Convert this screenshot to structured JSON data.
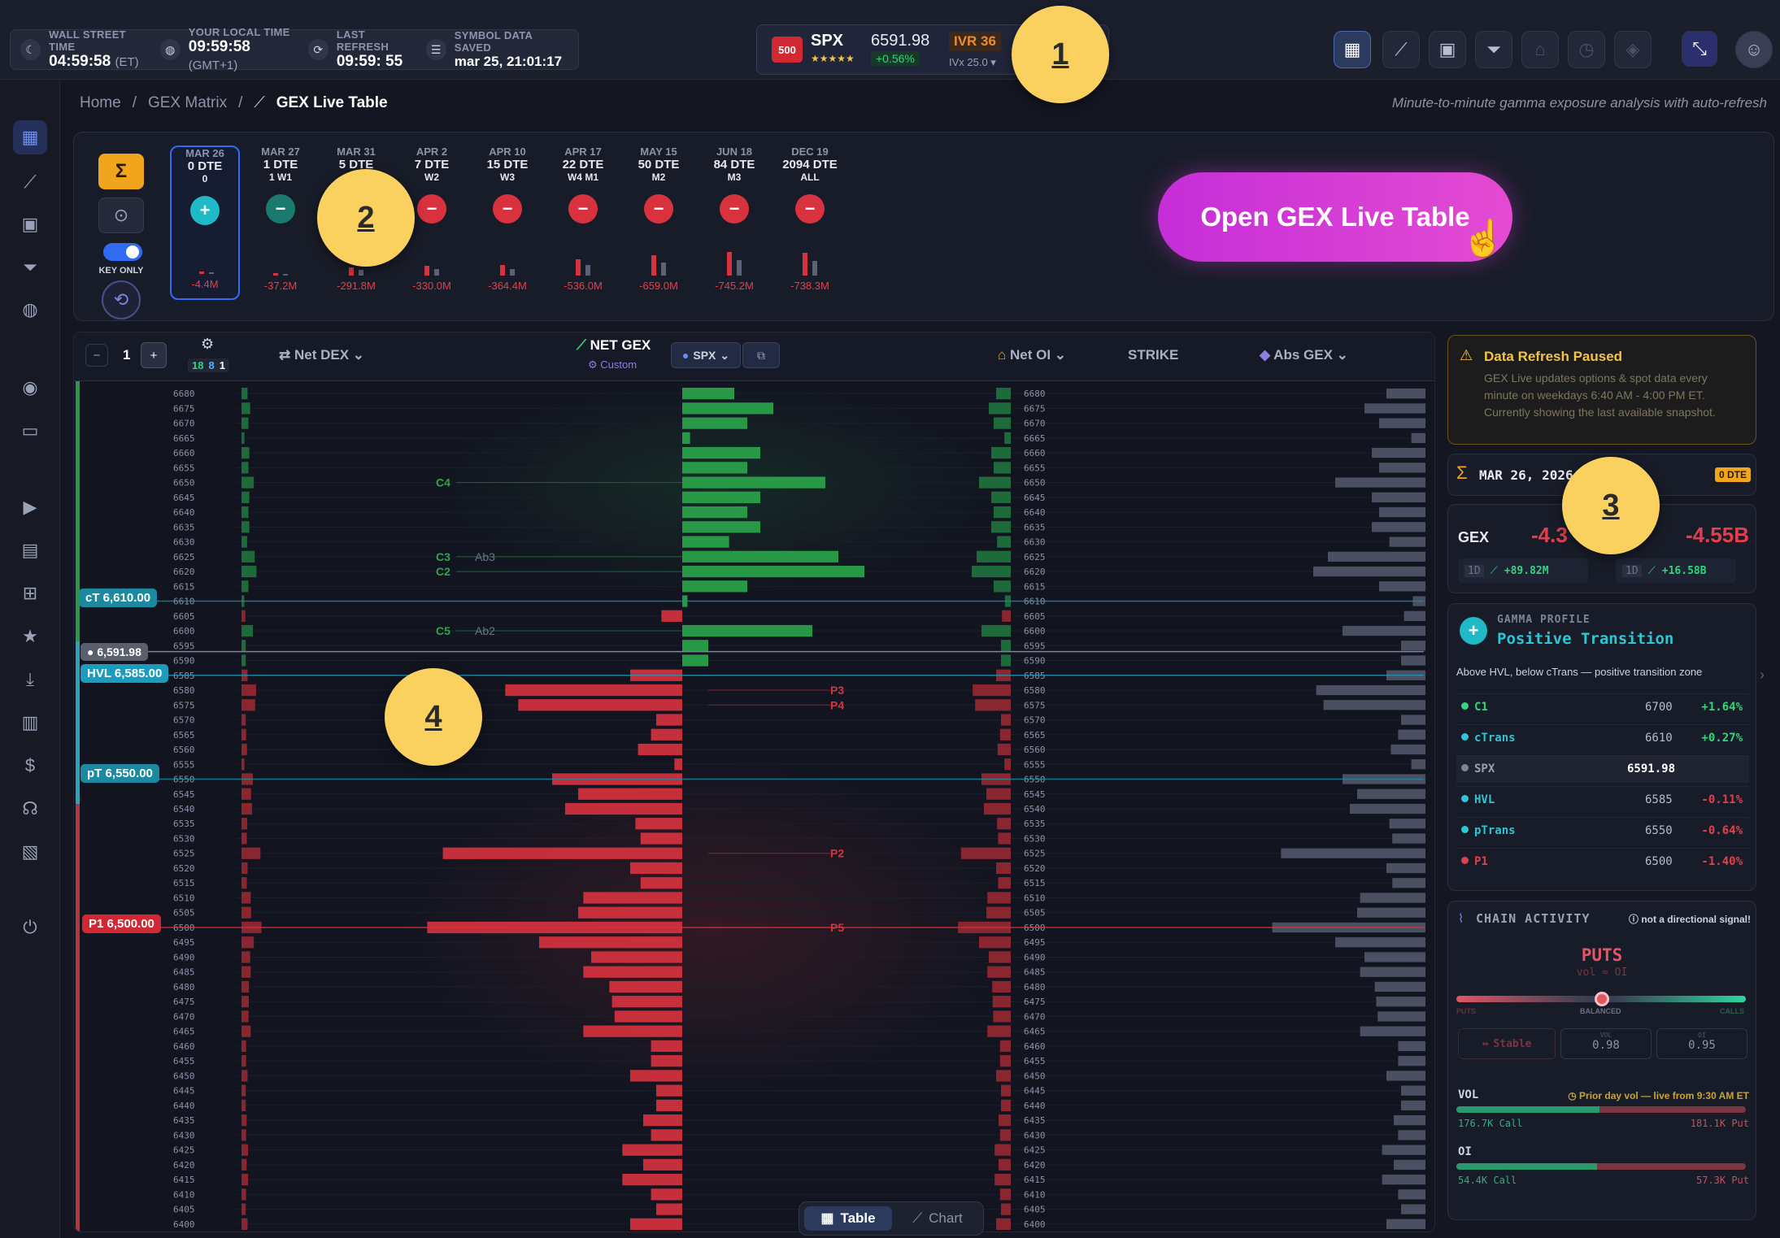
{
  "top": {
    "wall_street_label": "WALL STREET TIME",
    "wall_street_value": "04:59:58",
    "wall_street_suffix": "(ET)",
    "local_label": "YOUR LOCAL TIME",
    "local_value": "09:59:58",
    "local_suffix": "(GMT+1)",
    "refresh_label": "LAST REFRESH",
    "refresh_value": "09:59: 55",
    "saved_label": "SYMBOL DATA SAVED",
    "saved_value": "mar 25, 21:01:17",
    "badge": "500",
    "symbol": "SPX",
    "price": "6591.98",
    "stars": "★★★★★",
    "change": "+0.56%",
    "ivr": "IVR 36",
    "ivx": "IVx 25.0 ▾"
  },
  "callouts": [
    "1",
    "2",
    "3",
    "4"
  ],
  "breadcrumb": {
    "home": "Home",
    "matrix": "GEX Matrix",
    "current": "GEX Live Table",
    "sep": "/"
  },
  "subtitle": "Minute-to-minute gamma exposure analysis with auto-refresh",
  "expiry_panel": {
    "key_only": "KEY ONLY",
    "expiries": [
      {
        "date": "MAR 26",
        "dte": "0 DTE",
        "tag": "0",
        "sign": "+",
        "value": "-4.4M",
        "bar": 0.02
      },
      {
        "date": "MAR 27",
        "dte": "1 DTE",
        "tag": "1  W1",
        "sign": "−",
        "value": "-37.2M",
        "bar": 0.05
      },
      {
        "date": "MAR 31",
        "dte": "5 DTE",
        "tag": "W2",
        "sign": "−",
        "value": "-291.8M",
        "bar": 0.3
      },
      {
        "date": "APR 2",
        "dte": "7 DTE",
        "tag": "W2",
        "sign": "−",
        "value": "-330.0M",
        "bar": 0.35
      },
      {
        "date": "APR 10",
        "dte": "15 DTE",
        "tag": "W3",
        "sign": "−",
        "value": "-364.4M",
        "bar": 0.38
      },
      {
        "date": "APR 17",
        "dte": "22 DTE",
        "tag": "W4  M1",
        "sign": "−",
        "value": "-536.0M",
        "bar": 0.6
      },
      {
        "date": "MAY 15",
        "dte": "50 DTE",
        "tag": "M2",
        "sign": "−",
        "value": "-659.0M",
        "bar": 0.75
      },
      {
        "date": "JUN 18",
        "dte": "84 DTE",
        "tag": "M3",
        "sign": "−",
        "value": "-745.2M",
        "bar": 0.85
      },
      {
        "date": "DEC 19",
        "dte": "2094 DTE",
        "tag": "ALL",
        "sign": "−",
        "value": "-738.3M",
        "bar": 0.82
      }
    ],
    "cta": "Open GEX Live Table"
  },
  "table_header": {
    "zoom_value": "1",
    "counts": [
      "18",
      "8",
      "1"
    ],
    "net_dex": "Net DEX",
    "net_gex": "NET GEX",
    "custom": "Custom",
    "symbol": "SPX",
    "net_oi": "Net OI",
    "strike": "STRIKE",
    "abs_gex": "Abs GEX"
  },
  "levels": {
    "ct": "cT 6,610.00",
    "spot": "6,591.98",
    "hvl": "HVL 6,585.00",
    "pt": "pT 6,550.00",
    "p1": "P1 6,500.00"
  },
  "annotations": [
    "C4",
    "C3",
    "Ab3",
    "C2",
    "C5",
    "Ab2",
    "P3",
    "P4",
    "P2",
    "P5"
  ],
  "strikes": {
    "start": 6680,
    "end": 6400,
    "step": 5
  },
  "chart_data": {
    "type": "bar",
    "x": [
      6680,
      6675,
      6670,
      6665,
      6660,
      6655,
      6650,
      6645,
      6640,
      6635,
      6630,
      6625,
      6620,
      6615,
      6610,
      6605,
      6600,
      6595,
      6590,
      6585,
      6580,
      6575,
      6570,
      6565,
      6560,
      6555,
      6550,
      6545,
      6540,
      6535,
      6530,
      6525,
      6520,
      6515,
      6510,
      6505,
      6500,
      6495,
      6490,
      6485,
      6480,
      6475,
      6470,
      6465,
      6460,
      6455,
      6450,
      6445,
      6440,
      6435,
      6430,
      6425,
      6420,
      6415,
      6410,
      6405,
      6400
    ],
    "series": [
      {
        "values": [
          0.2,
          0.35,
          0.25,
          0.03,
          0.3,
          0.25,
          0.55,
          0.3,
          0.25,
          0.3,
          0.18,
          0.6,
          0.7,
          0.25,
          0.02,
          -0.08,
          0.5,
          0.1,
          0.1,
          -0.2,
          -0.68,
          -0.63,
          -0.1,
          -0.12,
          -0.17,
          -0.03,
          -0.5,
          -0.4,
          -0.45,
          -0.18,
          -0.16,
          -0.92,
          -0.2,
          -0.16,
          -0.38,
          -0.4,
          -0.98,
          -0.55,
          -0.35,
          -0.38,
          -0.28,
          -0.27,
          -0.26,
          -0.38,
          -0.12,
          -0.12,
          -0.2,
          -0.1,
          -0.1,
          -0.15,
          -0.12,
          -0.23,
          -0.15,
          -0.23,
          -0.12,
          -0.1,
          -0.2
        ]
      }
    ]
  },
  "right": {
    "warning_title": "Data Refresh Paused",
    "warning_body": "GEX Live updates options & spot data every minute on weekdays 6:40 AM - 4:00 PM ET. Currently showing the last available snapshot.",
    "date": "MAR 26, 2026",
    "dte_badge": "0 DTE",
    "gex_label": "GEX",
    "gex_value": "-4.3",
    "gex_total": "-4.55B",
    "chip1_tf": "1D",
    "chip1_val": "+89.82M",
    "chip2_tf": "1D",
    "chip2_val": "+16.58B",
    "profile_label": "GAMMA PROFILE",
    "profile_value": "Positive Transition",
    "profile_desc": "Above HVL, below cTrans — positive transition zone",
    "profile_rows": [
      {
        "name": "C1",
        "value": "6700",
        "pct": "+1.64%",
        "color": "#2fd67a"
      },
      {
        "name": "cTrans",
        "value": "6610",
        "pct": "+0.27%",
        "color": "#2cc6d4"
      },
      {
        "name": "SPX",
        "value": "6591.98",
        "pct": "",
        "color": "#7d8497"
      },
      {
        "name": "HVL",
        "value": "6585",
        "pct": "-0.11%",
        "color": "#2cc6d4"
      },
      {
        "name": "pTrans",
        "value": "6550",
        "pct": "-0.64%",
        "color": "#2cc6d4"
      },
      {
        "name": "P1",
        "value": "6500",
        "pct": "-1.40%",
        "color": "#e0404c"
      }
    ],
    "chain_label": "CHAIN ACTIVITY",
    "chain_note": "not a directional signal!",
    "puts": "PUTS",
    "puts_sub": "vol ≈ OI",
    "gauge_left": "PUTS",
    "gauge_mid": "BALANCED",
    "gauge_right": "CALLS",
    "stable": "Stable",
    "vol_label_small": "VOL",
    "vol_ratio": "0.98",
    "oi_label_small": "OI",
    "oi_ratio": "0.95",
    "vol_label": "VOL",
    "vol_note": "Prior day vol — live from 9:30 AM ET",
    "vol_call": "176.7K Call",
    "vol_put": "181.1K Put",
    "oi_label": "OI",
    "oi_call": "54.4K Call",
    "oi_put": "57.3K Put"
  },
  "toggle": {
    "table": "Table",
    "chart": "Chart"
  }
}
